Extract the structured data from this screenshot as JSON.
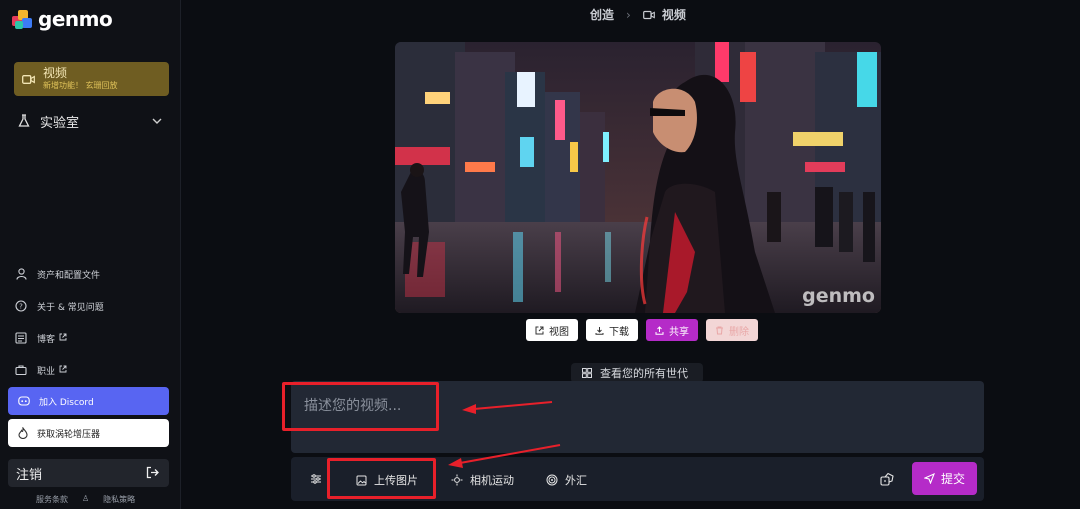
{
  "brand": {
    "name": "genmo"
  },
  "sidebar": {
    "video": {
      "label": "视频",
      "sub": "新增功能！ 玄珊回放"
    },
    "lab": {
      "label": "实验室"
    },
    "links": [
      {
        "label": "资产和配置文件",
        "icon": "user-icon"
      },
      {
        "label": "关于 & 常见问题",
        "icon": "help-circle-icon"
      },
      {
        "label": "博客",
        "icon": "blog-icon"
      },
      {
        "label": "职业",
        "icon": "briefcase-icon"
      }
    ],
    "discord": {
      "label": "加入 Discord"
    },
    "booster": {
      "label": "获取涡轮增压器"
    },
    "logout": {
      "label": "注销"
    },
    "footer": {
      "terms": "服务条款",
      "privacy": "隐私策略"
    }
  },
  "breadcrumb": {
    "create": "创造",
    "current": "视频"
  },
  "preview": {
    "watermark": "genmo"
  },
  "actions": {
    "view": "视图",
    "download": "下载",
    "share": "共享",
    "delete": "删除"
  },
  "see_all": {
    "label": "查看您的所有世代"
  },
  "prompt": {
    "placeholder": "描述您的视频..."
  },
  "toolbar": {
    "upload": "上传图片",
    "camera": "相机运动",
    "fx": "外汇",
    "submit": "提交"
  },
  "colors": {
    "accent": "#b52bc8",
    "video_nav": "#6f5d22",
    "discord": "#5865f2",
    "annotation": "#e8202a"
  }
}
